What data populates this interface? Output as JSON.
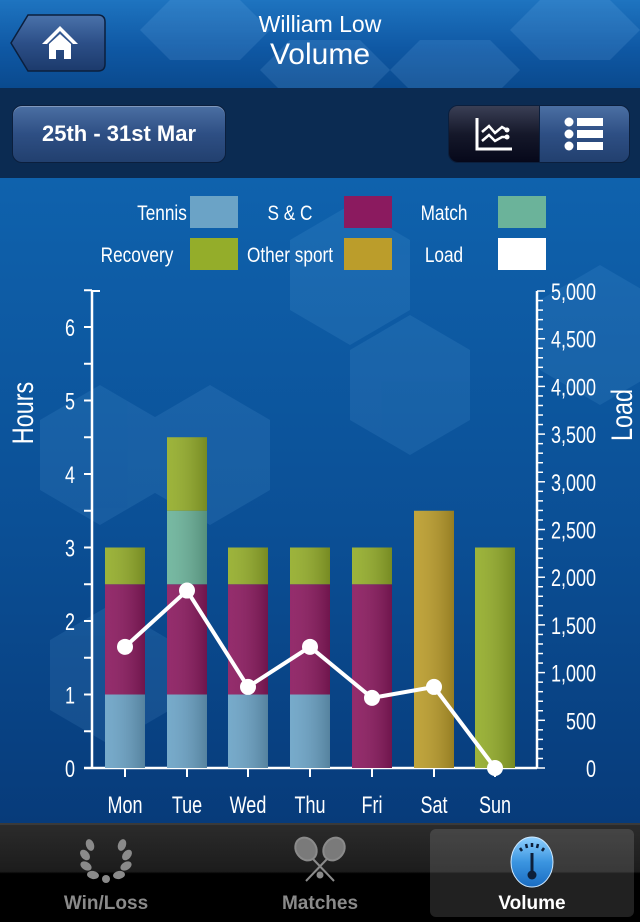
{
  "header": {
    "user_name": "William Low",
    "page_title": "Volume",
    "home_icon": "home-icon"
  },
  "toolbar": {
    "date_range": "25th - 31st Mar",
    "view_toggle": [
      {
        "name": "chart-view",
        "icon": "line-chart-icon",
        "active": true
      },
      {
        "name": "list-view",
        "icon": "list-icon",
        "active": false
      }
    ]
  },
  "colors": {
    "tennis": "#6ba3c6",
    "sc": "#8b1a5f",
    "match": "#6bb39a",
    "recovery": "#94ad2a",
    "other_sport": "#bb9d2b",
    "load": "#ffffff"
  },
  "chart_data": {
    "type": "bar",
    "stacked": true,
    "title": "",
    "categories": [
      "Mon",
      "Tue",
      "Wed",
      "Thu",
      "Fri",
      "Sat",
      "Sun"
    ],
    "ylabel": "Hours",
    "ylim": [
      0,
      6.5
    ],
    "yticks": [
      0,
      1,
      2,
      3,
      4,
      5,
      6
    ],
    "y2label": "Load",
    "y2lim": [
      0,
      5000
    ],
    "y2ticks": [
      "0",
      "500",
      "1,000",
      "1,500",
      "2,000",
      "2,500",
      "3,000",
      "3,500",
      "4,000",
      "4,500",
      "5,000"
    ],
    "legend": [
      {
        "label": "Tennis",
        "key": "tennis"
      },
      {
        "label": "S & C",
        "key": "sc"
      },
      {
        "label": "Match",
        "key": "match"
      },
      {
        "label": "Recovery",
        "key": "recovery"
      },
      {
        "label": "Other sport",
        "key": "other_sport"
      },
      {
        "label": "Load",
        "key": "load"
      }
    ],
    "legend_position": "top",
    "series": [
      {
        "name": "Tennis",
        "key": "tennis",
        "values": [
          1,
          1,
          1,
          1,
          0,
          0,
          0
        ]
      },
      {
        "name": "S & C",
        "key": "sc",
        "values": [
          1.5,
          1.5,
          1.5,
          1.5,
          2.5,
          0,
          0
        ]
      },
      {
        "name": "Match",
        "key": "match",
        "values": [
          0,
          1,
          0,
          0,
          0,
          0,
          0
        ]
      },
      {
        "name": "Recovery",
        "key": "recovery",
        "values": [
          0.5,
          1,
          0.5,
          0.5,
          0.5,
          0,
          3
        ]
      },
      {
        "name": "Other sport",
        "key": "other_sport",
        "values": [
          0,
          0,
          0,
          0,
          0,
          3.5,
          0
        ]
      }
    ],
    "line_series": {
      "name": "Load",
      "key": "load",
      "axis": "right",
      "values": [
        1270,
        1860,
        850,
        1270,
        735,
        850,
        0
      ]
    }
  },
  "tabbar": {
    "tabs": [
      {
        "label": "Win/Loss",
        "icon": "laurel-icon",
        "active": false
      },
      {
        "label": "Matches",
        "icon": "tennis-rackets-icon",
        "active": false
      },
      {
        "label": "Volume",
        "icon": "gauge-icon",
        "active": true
      }
    ]
  }
}
